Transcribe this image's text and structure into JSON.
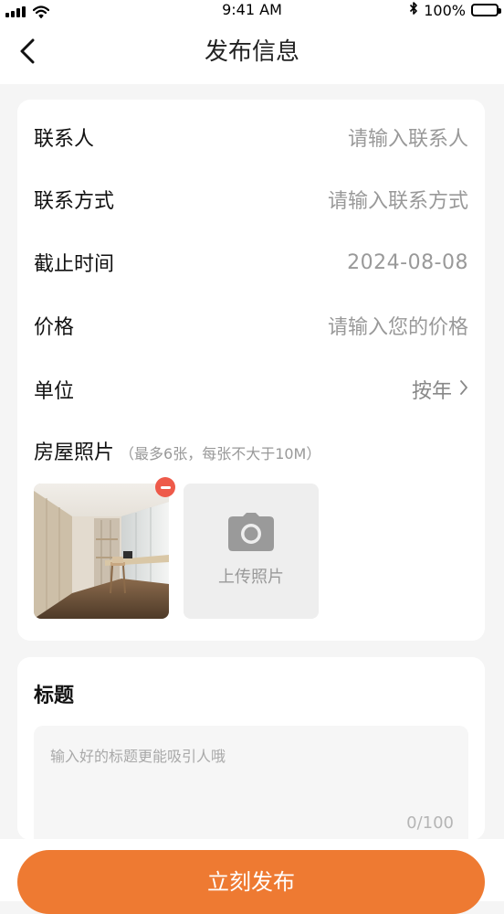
{
  "status_bar": {
    "time": "9:41 AM",
    "battery": "100%"
  },
  "nav": {
    "title": "发布信息"
  },
  "form": {
    "contact_name": {
      "label": "联系人",
      "placeholder": "请输入联系人"
    },
    "contact_method": {
      "label": "联系方式",
      "placeholder": "请输入联系方式"
    },
    "deadline": {
      "label": "截止时间",
      "value": "2024-08-08"
    },
    "price": {
      "label": "价格",
      "placeholder": "请输入您的价格"
    },
    "unit": {
      "label": "单位",
      "value": "按年"
    },
    "photos": {
      "label": "房屋照片",
      "hint": "（最多6张，每张不大于10M）",
      "upload_label": "上传照片"
    }
  },
  "title_section": {
    "heading": "标题",
    "placeholder": "输入好的标题更能吸引人哦",
    "char_count": "0/100"
  },
  "submit": {
    "label": "立刻发布"
  },
  "colors": {
    "accent": "#ee7a32",
    "remove_badge": "#ee5a4a"
  },
  "icons": {
    "back": "back-arrow-icon",
    "chevron": "chevron-right-icon",
    "camera": "camera-icon",
    "remove": "remove-icon"
  }
}
